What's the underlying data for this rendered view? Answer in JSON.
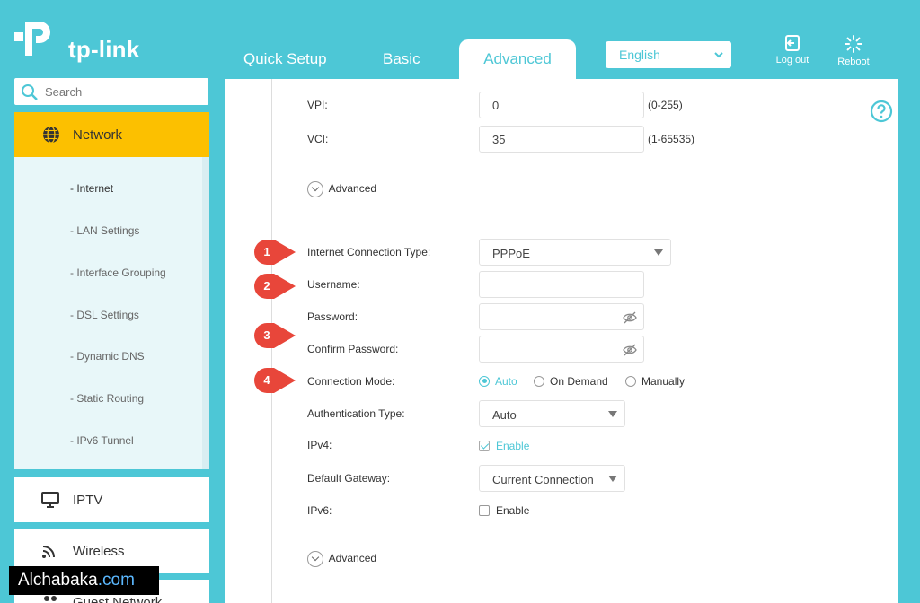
{
  "brand": {
    "name": "tp-link"
  },
  "nav": {
    "tabs": [
      {
        "label": "Quick Setup"
      },
      {
        "label": "Basic"
      },
      {
        "label": "Advanced"
      }
    ],
    "language": "English",
    "logout_label": "Log out",
    "reboot_label": "Reboot"
  },
  "sidebar": {
    "search_placeholder": "Search",
    "active_section": "Network",
    "network_items": [
      {
        "label": "- Internet"
      },
      {
        "label": "- LAN Settings"
      },
      {
        "label": "- Interface Grouping"
      },
      {
        "label": "- DSL Settings"
      },
      {
        "label": "- Dynamic DNS"
      },
      {
        "label": "- Static Routing"
      },
      {
        "label": "- IPv6 Tunnel"
      }
    ],
    "sections": [
      {
        "label": "IPTV"
      },
      {
        "label": "Wireless"
      },
      {
        "label": "Guest Network"
      }
    ]
  },
  "form": {
    "vpi": {
      "label": "VPI:",
      "value": "0",
      "hint": "(0-255)"
    },
    "vci": {
      "label": "VCI:",
      "value": "35",
      "hint": "(1-65535)"
    },
    "advanced_label": "Advanced",
    "connection_type": {
      "label": "Internet Connection Type:",
      "value": "PPPoE"
    },
    "username": {
      "label": "Username:",
      "value": ""
    },
    "password": {
      "label": "Password:",
      "value": ""
    },
    "confirm_password": {
      "label": "Confirm Password:",
      "value": ""
    },
    "connection_mode": {
      "label": "Connection Mode:",
      "options": [
        "Auto",
        "On Demand",
        "Manually"
      ],
      "selected": "Auto"
    },
    "auth_type": {
      "label": "Authentication Type:",
      "value": "Auto"
    },
    "ipv4": {
      "label": "IPv4:",
      "checkbox_label": "Enable",
      "checked": true
    },
    "default_gateway": {
      "label": "Default Gateway:",
      "value": "Current Connection"
    },
    "ipv6": {
      "label": "IPv6:",
      "checkbox_label": "Enable",
      "checked": false
    },
    "advanced_label_2": "Advanced"
  },
  "markers": [
    "1",
    "2",
    "3",
    "4"
  ],
  "watermark": {
    "text": "Alchabaka",
    "suffix": ".com"
  },
  "colors": {
    "teal": "#4dc7d6",
    "yellow": "#fcc000",
    "marker_red": "#e8463a"
  }
}
